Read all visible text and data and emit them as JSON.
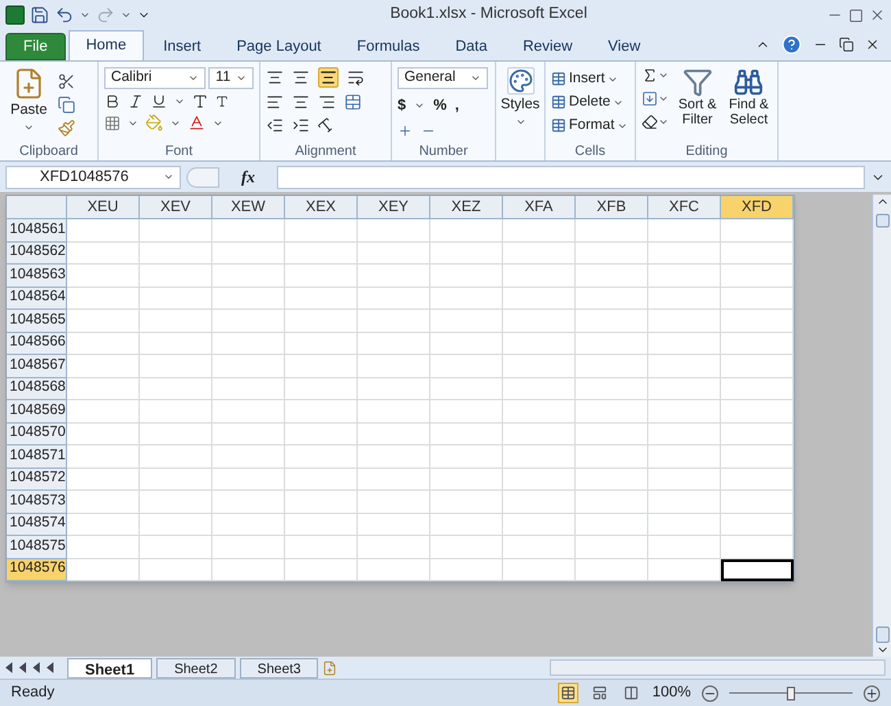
{
  "window": {
    "title": "Book1.xlsx - Microsoft Excel"
  },
  "tabs": [
    {
      "label": "File",
      "kind": "file",
      "selected": false
    },
    {
      "label": "Home",
      "kind": "tab",
      "selected": true
    },
    {
      "label": "Insert",
      "kind": "tab",
      "selected": false
    },
    {
      "label": "Page Layout",
      "kind": "tab",
      "selected": false
    },
    {
      "label": "Formulas",
      "kind": "tab",
      "selected": false
    },
    {
      "label": "Data",
      "kind": "tab",
      "selected": false
    },
    {
      "label": "Review",
      "kind": "tab",
      "selected": false
    },
    {
      "label": "View",
      "kind": "tab",
      "selected": false
    }
  ],
  "ribbon": {
    "paste": "Paste",
    "font": "Calibri",
    "font_size": "11",
    "number_format": "General",
    "dollar": "$",
    "percent": "%",
    "comma": ",",
    "styles": "Styles",
    "insert": "Insert",
    "delete": "Delete",
    "format": "Format",
    "sort_filter": "Sort & Filter",
    "find_select": "Find & Select",
    "groups": [
      "Clipboard",
      "Font",
      "Alignment",
      "Number",
      "Cells",
      "Editing"
    ]
  },
  "name_box": "XFD1048576",
  "function_label": "fx",
  "grid": {
    "columns": [
      {
        "label": "XEU",
        "selected": false
      },
      {
        "label": "XEV",
        "selected": false
      },
      {
        "label": "XEW",
        "selected": false
      },
      {
        "label": "XEX",
        "selected": false
      },
      {
        "label": "XEY",
        "selected": false
      },
      {
        "label": "XEZ",
        "selected": false
      },
      {
        "label": "XFA",
        "selected": false
      },
      {
        "label": "XFB",
        "selected": false
      },
      {
        "label": "XFC",
        "selected": false
      },
      {
        "label": "XFD",
        "selected": true
      }
    ],
    "rows": [
      {
        "label": "1048561",
        "selected": false
      },
      {
        "label": "1048562",
        "selected": false
      },
      {
        "label": "1048563",
        "selected": false
      },
      {
        "label": "1048564",
        "selected": false
      },
      {
        "label": "1048565",
        "selected": false
      },
      {
        "label": "1048566",
        "selected": false
      },
      {
        "label": "1048567",
        "selected": false
      },
      {
        "label": "1048568",
        "selected": false
      },
      {
        "label": "1048569",
        "selected": false
      },
      {
        "label": "1048570",
        "selected": false
      },
      {
        "label": "1048571",
        "selected": false
      },
      {
        "label": "1048572",
        "selected": false
      },
      {
        "label": "1048573",
        "selected": false
      },
      {
        "label": "1048574",
        "selected": false
      },
      {
        "label": "1048575",
        "selected": false
      },
      {
        "label": "1048576",
        "selected": true
      }
    ]
  },
  "sheets": [
    {
      "label": "Sheet1",
      "selected": true
    },
    {
      "label": "Sheet2",
      "selected": false
    },
    {
      "label": "Sheet3",
      "selected": false
    }
  ],
  "status": "Ready",
  "views": [
    {
      "kind": "normal",
      "selected": true
    },
    {
      "kind": "page-layout",
      "selected": false
    },
    {
      "kind": "page-break",
      "selected": false
    }
  ],
  "zoom": {
    "reading": "100%",
    "level": 0.5
  }
}
